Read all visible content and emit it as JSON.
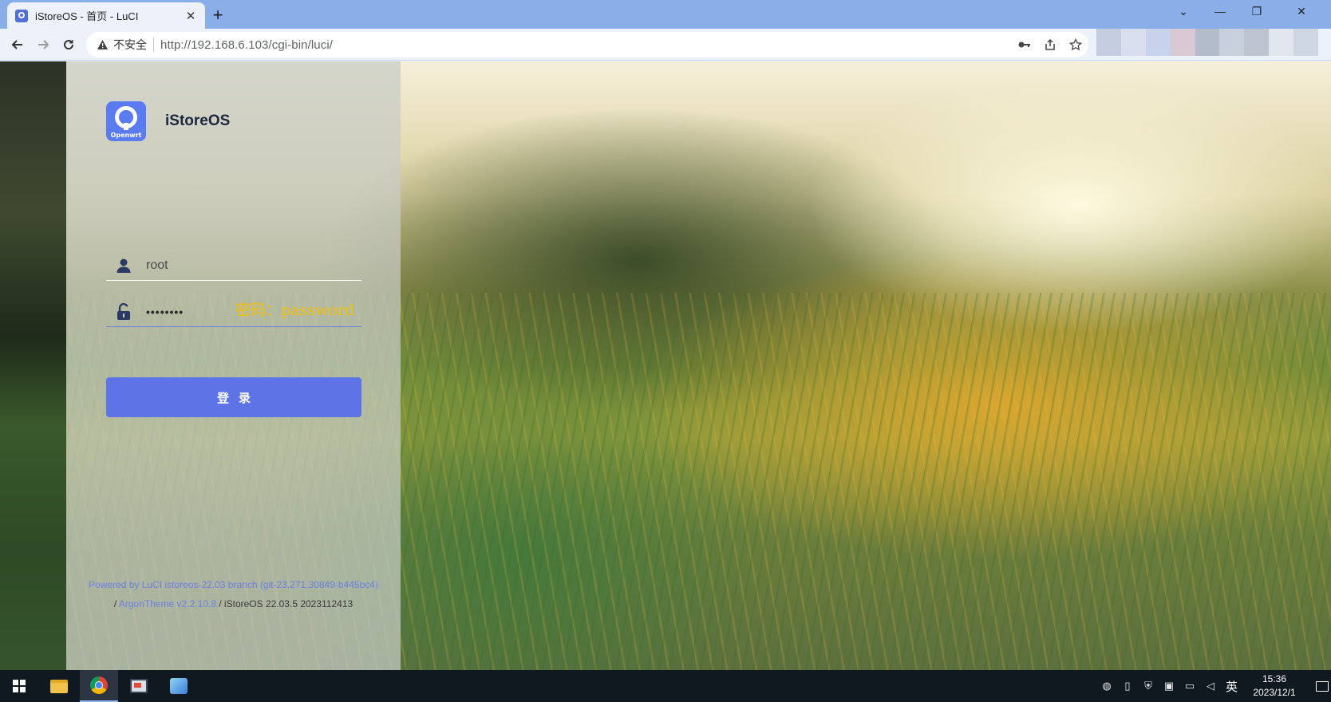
{
  "browser": {
    "tab_title": "iStoreOS - 首页 - LuCI",
    "tab_close": "✕",
    "new_tab": "+",
    "security_label": "不安全",
    "url": "http://192.168.6.103/cgi-bin/luci/",
    "window_controls": {
      "dropdown": "⌄",
      "minimize": "—",
      "restore": "❐",
      "close": "✕"
    }
  },
  "login": {
    "brand_name": "iStoreOS",
    "logo_text": "Openwrt",
    "username_value": "root",
    "password_dots": "••••••••",
    "password_annotation": "密码：password",
    "submit_label": "登录"
  },
  "footer": {
    "powered_by": "Powered by LuCI istoreos-22.03 branch (git-23.271.30849-b445bc4)",
    "separator": "/",
    "theme_link": "ArgonTheme v2.2.10.8",
    "version_text": "/ iStoreOS 22.03.5 2023112413"
  },
  "taskbar": {
    "ime_label": "英",
    "clock_time": "15:36",
    "clock_date": "2023/12/1"
  },
  "colors": {
    "accent": "#5d73e6",
    "annotation": "#f2c00a",
    "brand_text": "#1c2740",
    "link": "#6b7fe3"
  }
}
